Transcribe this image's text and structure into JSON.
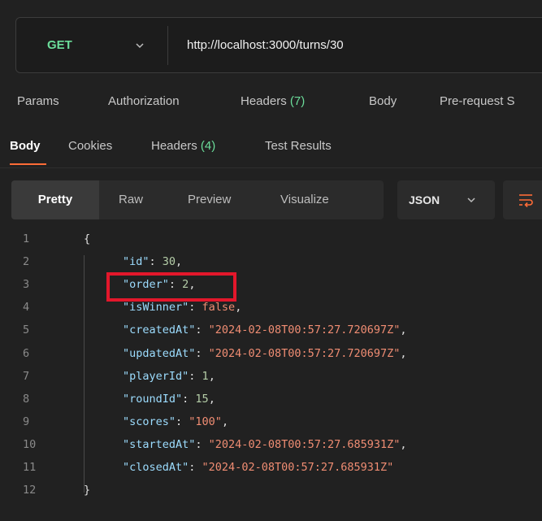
{
  "request": {
    "method": "GET",
    "url": "http://localhost:3000/turns/30"
  },
  "request_tabs": {
    "params": "Params",
    "authorization": "Authorization",
    "headers": "Headers",
    "headers_count": "(7)",
    "body": "Body",
    "prerequest": "Pre-request S"
  },
  "response_tabs": {
    "body": "Body",
    "cookies": "Cookies",
    "headers": "Headers",
    "headers_count": "(4)",
    "test_results": "Test Results"
  },
  "format": {
    "pretty": "Pretty",
    "raw": "Raw",
    "preview": "Preview",
    "visualize": "Visualize",
    "language": "JSON"
  },
  "code": {
    "lines": [
      {
        "n": "1",
        "open": "{"
      },
      {
        "n": "2",
        "key": "\"id\"",
        "value": "30",
        "type": "num",
        "comma": ","
      },
      {
        "n": "3",
        "key": "\"order\"",
        "value": "2",
        "type": "num",
        "comma": ","
      },
      {
        "n": "4",
        "key": "\"isWinner\"",
        "value": "false",
        "type": "bool",
        "comma": ","
      },
      {
        "n": "5",
        "key": "\"createdAt\"",
        "value": "\"2024-02-08T00:57:27.720697Z\"",
        "type": "str",
        "comma": ","
      },
      {
        "n": "6",
        "key": "\"updatedAt\"",
        "value": "\"2024-02-08T00:57:27.720697Z\"",
        "type": "str",
        "comma": ","
      },
      {
        "n": "7",
        "key": "\"playerId\"",
        "value": "1",
        "type": "num",
        "comma": ","
      },
      {
        "n": "8",
        "key": "\"roundId\"",
        "value": "15",
        "type": "num",
        "comma": ","
      },
      {
        "n": "9",
        "key": "\"scores\"",
        "value": "\"100\"",
        "type": "str",
        "comma": ","
      },
      {
        "n": "10",
        "key": "\"startedAt\"",
        "value": "\"2024-02-08T00:57:27.685931Z\"",
        "type": "str",
        "comma": ","
      },
      {
        "n": "11",
        "key": "\"closedAt\"",
        "value": "\"2024-02-08T00:57:27.685931Z\"",
        "type": "str",
        "comma": ""
      },
      {
        "n": "12",
        "close": "}"
      }
    ]
  },
  "colors": {
    "accent": "#ff6c37",
    "method": "#6bdd9a",
    "highlight_box": "#e3172b"
  }
}
